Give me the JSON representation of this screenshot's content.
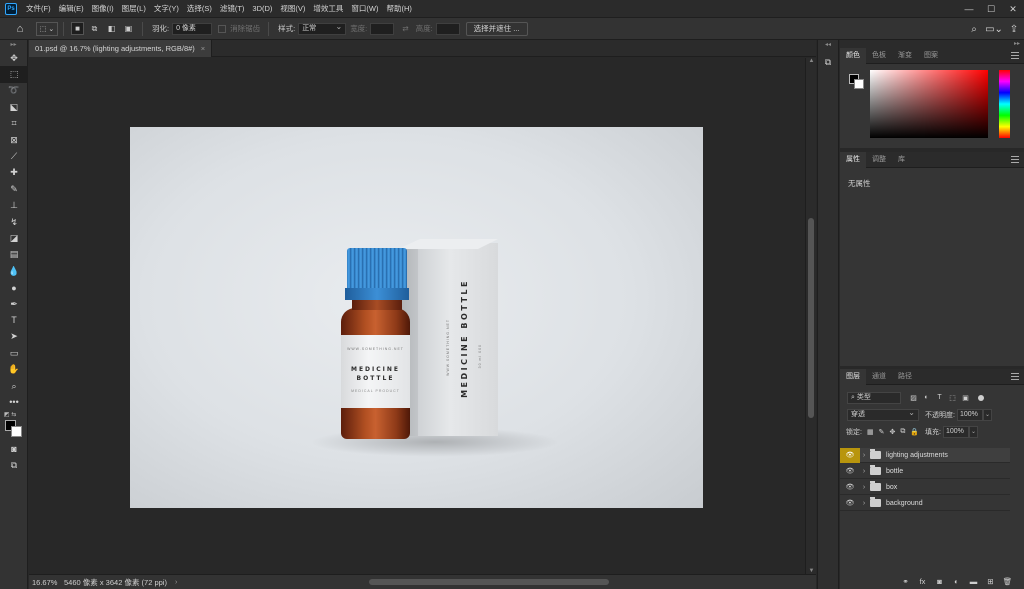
{
  "app": {
    "logo": "Ps"
  },
  "menu": [
    "文件(F)",
    "编辑(E)",
    "图像(I)",
    "图层(L)",
    "文字(Y)",
    "选择(S)",
    "滤镜(T)",
    "3D(D)",
    "视图(V)",
    "增效工具",
    "窗口(W)",
    "帮助(H)"
  ],
  "window_controls": {
    "minimize": "—",
    "maximize": "☐",
    "close": "✕"
  },
  "options": {
    "home_icon": "home-icon",
    "feather_label": "羽化:",
    "feather_value": "0 像素",
    "antialias_label": "消除锯齿",
    "style_label": "样式:",
    "style_value": "正常",
    "width_label": "宽度:",
    "height_label": "高度:",
    "select_mask_button": "选择并遮住 ..."
  },
  "document": {
    "tab_title": "01.psd @ 16.7% (lighting adjustments, RGB/8#)",
    "tab_close": "×"
  },
  "artwork": {
    "box_title": "MEDICINE BOTTLE",
    "box_small_text": "WWW.SOMETHING.NET",
    "box_small_text2": "30 ml 000",
    "label_small_top": "WWW.SOMETHING.NET",
    "label_title_line1": "MEDICINE",
    "label_title_line2": "BOTTLE",
    "label_small_bottom": "MEDICAL PRODUCT"
  },
  "status": {
    "zoom": "16.67%",
    "doc_info": "5460 像素 x 3642 像素 (72 ppi)",
    "arrow": "›"
  },
  "color_panel": {
    "tabs": [
      "颜色",
      "色板",
      "渐变",
      "图案"
    ],
    "active": 0
  },
  "properties_panel": {
    "tabs": [
      "属性",
      "调整",
      "库"
    ],
    "active": 0,
    "content": "无属性"
  },
  "layers_panel": {
    "tabs": [
      "图层",
      "通道",
      "路径"
    ],
    "active": 0,
    "filter_value": "类型",
    "blend_mode": "穿透",
    "opacity_label": "不透明度:",
    "opacity_value": "100%",
    "lock_label": "锁定:",
    "fill_label": "填充:",
    "fill_value": "100%",
    "layers": [
      {
        "name": "lighting adjustments",
        "selected": true
      },
      {
        "name": "bottle",
        "selected": false
      },
      {
        "name": "box",
        "selected": false
      },
      {
        "name": "background",
        "selected": false
      }
    ],
    "footer_icons": [
      "link-icon",
      "fx-icon",
      "mask-icon",
      "adjustment-icon",
      "group-icon",
      "new-layer-icon",
      "trash-icon"
    ]
  },
  "colors": {
    "accent_selected_eye": "#b8950d",
    "cap_blue": "#2f7fc4",
    "bottle_amber": "#b14f22"
  }
}
